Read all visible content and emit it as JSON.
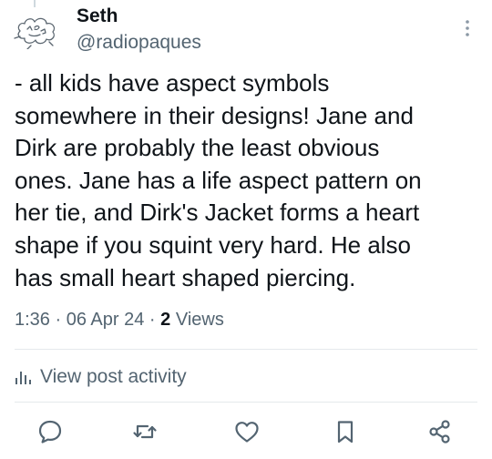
{
  "post": {
    "author": {
      "display_name": "Seth",
      "handle": "@radiopaques",
      "avatar_icon": "doodle-avatar-icon"
    },
    "text": "- all kids have aspect symbols\nsomewhere in their designs! Jane and\nDirk are probably the least obvious\nones. Jane has a life aspect pattern on\nher tie, and Dirk's Jacket forms a heart\nshape if you squint very hard. He also\nhas small heart shaped piercing.",
    "time": "1:36",
    "separator": "·",
    "date": "06 Apr 24",
    "views_count": "2",
    "views_label": "Views"
  },
  "activity": {
    "label": "View post activity",
    "icon": "analytics-bars-icon"
  },
  "actions": {
    "reply_icon": "reply-bubble-icon",
    "repost_icon": "repost-icon",
    "like_icon": "heart-icon",
    "bookmark_icon": "bookmark-icon",
    "share_icon": "share-icon"
  },
  "colors": {
    "text_primary": "#0f1419",
    "text_secondary": "#536471",
    "divider": "#e5e9ec"
  }
}
